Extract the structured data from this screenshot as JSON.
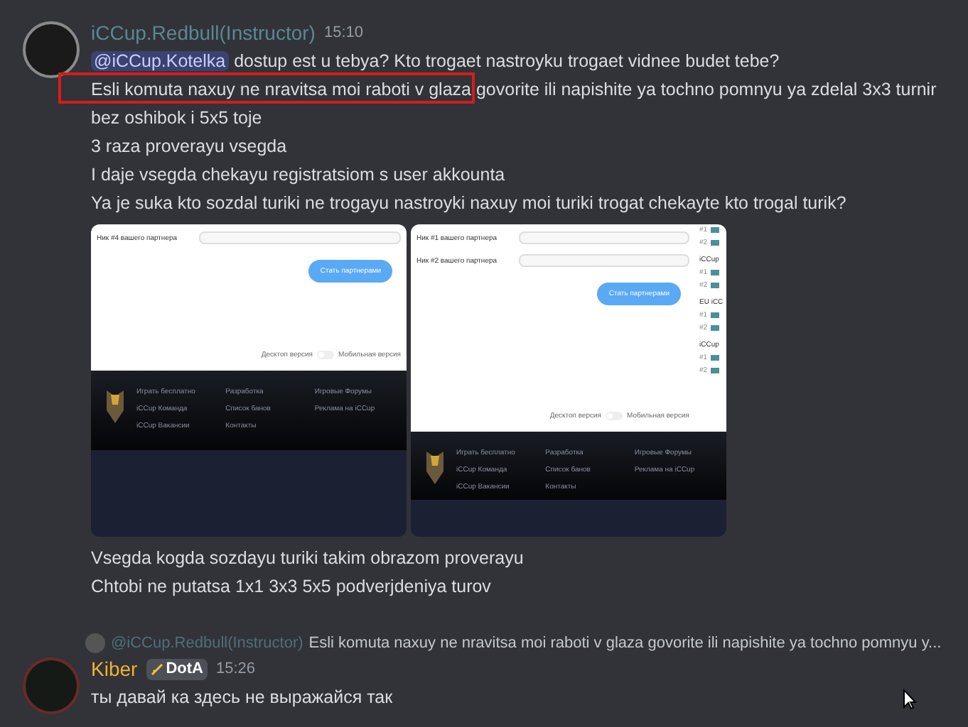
{
  "messages": [
    {
      "author": "iCCup.Redbull(Instructor)",
      "color": "#5b8795",
      "time": "15:10",
      "blocks": [
        {
          "kind": "text",
          "mention": "@iCCup.Kotelka",
          "text": "dostup est u tebya? Kto trogaet nastroyku trogaet vidnee budet tebe?",
          "boxed": false
        },
        {
          "kind": "text",
          "text": "Esli komuta naxuy ne nravitsa moi raboti v glaza govorite ili napishite ya tochno pomnyu ya zdelal 3x3 turnir bez oshibok i 5x5 toje",
          "boxed": true
        },
        {
          "kind": "text",
          "text": "3 raza proverayu vsegda",
          "boxed": false
        },
        {
          "kind": "text",
          "text": "I daje vsegda chekayu registratsiom s user akkounta",
          "boxed": false
        },
        {
          "kind": "text",
          "text": "Ya je suka kto sozdal turiki ne trogayu nastroyki naxuy moi turiki trogat chekayte kto trogal turik?",
          "boxed": false
        },
        {
          "kind": "images",
          "images": [
            {
              "fields": [
                "Ник #4 вашего партнера"
              ],
              "button": "Стать партнерами",
              "toggle": {
                "left": "Десктоп версия",
                "right": "Мобильная версия",
                "on": false
              },
              "footer_links": [
                [
                  "Играть бесплатно",
                  "iCCup Команда",
                  "iCCup Вакансии"
                ],
                [
                  "Разработка",
                  "Список банов",
                  "Контакты"
                ],
                [
                  "Игровые Форумы",
                  "Реклама на iCCup"
                ]
              ]
            },
            {
              "fields": [
                "Ник #1 вашего партнера",
                "Ник #2 вашего партнера"
              ],
              "button": "Стать партнерами",
              "toggle": {
                "left": "Десктоп версия",
                "right": "Мобильная версия",
                "on": false
              },
              "side_groups": [
                {
                  "items": [
                    "#1",
                    "#2"
                  ]
                },
                {
                  "heading": "iCCup",
                  "items": [
                    "#1",
                    "#2"
                  ]
                },
                {
                  "heading": "EU iCC",
                  "items": [
                    "#1",
                    "#2"
                  ]
                },
                {
                  "heading": "iCCup",
                  "items": [
                    "#1",
                    "#2"
                  ]
                }
              ],
              "footer_links": [
                [
                  "Играть бесплатно",
                  "iCCup Команда",
                  "iCCup Вакансии"
                ],
                [
                  "Разработка",
                  "Список банов",
                  "Контакты"
                ],
                [
                  "Игровые Форумы",
                  "Реклама на iCCup"
                ]
              ]
            }
          ]
        },
        {
          "kind": "text",
          "text": "Vsegda kogda sozdayu turiki takim obrazom proverayu",
          "boxed": false
        },
        {
          "kind": "text",
          "text": "Chtobi ne putatsa 1x1 3x3 5x5 podverjdeniya turov",
          "boxed": false
        }
      ]
    },
    {
      "reply": {
        "author": "@iCCup.Redbull(Instructor)",
        "text": "Esli komuta naxuy ne nravitsa moi raboti v glaza govorite ili napishite ya tochno pomnyu y..."
      },
      "author": "Kiber",
      "color": "#f0b232",
      "badge": "DotA",
      "time": "15:26",
      "blocks": [
        {
          "kind": "text",
          "text": "ты давай ка здесь не выражайся так",
          "boxed": false
        }
      ]
    }
  ]
}
